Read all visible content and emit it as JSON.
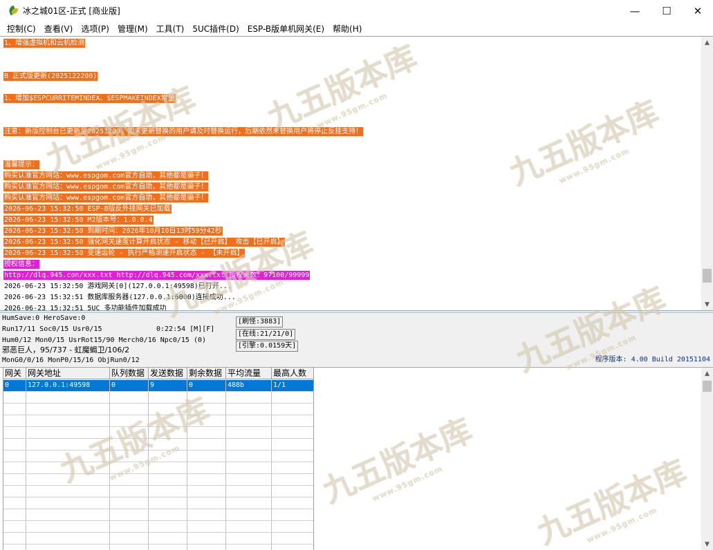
{
  "window": {
    "title": "冰之城01区-正式 [商业版]",
    "minimize": "—",
    "maximize": "☐",
    "close": "✕"
  },
  "menu": [
    {
      "label": "控制(C)"
    },
    {
      "label": "查看(V)"
    },
    {
      "label": "选项(P)"
    },
    {
      "label": "管理(M)"
    },
    {
      "label": "工具(T)"
    },
    {
      "label": "5UC插件(D)"
    },
    {
      "label": "ESP-B版单机网关(E)"
    },
    {
      "label": "帮助(H)"
    }
  ],
  "log": [
    {
      "text": "1、增强虚拟机和云机检测",
      "style": "orange"
    },
    {
      "text": "B 正式版更新(2025122200)",
      "style": "orange"
    },
    {
      "text": "1、增加$ESPCURRITEMINDEX、$ESPMAKEINDEX常量",
      "style": "orange"
    },
    {
      "text": "注意：新版控制台已更新至20251209，如未更新替换的用户请及时替换运行，后期依然未替换用户将停止反挂支持！",
      "style": "orange"
    },
    {
      "text": "温馨提示：",
      "style": "orange"
    },
    {
      "text": "购买认准官方网站：www.espgom.com官方自助，其他都是骗子！",
      "style": "orange"
    },
    {
      "text": "购买认准官方网站：www.espgom.com官方自助，其他都是骗子！",
      "style": "orange"
    },
    {
      "text": "购买认准官方网站：www.espgom.com官方自助，其他都是骗子！",
      "style": "orange"
    },
    {
      "text": "2026-06-23 15:32:50 ESP-B版反外挂网关已加载",
      "style": "orange"
    },
    {
      "text": "2026-06-23 15:32:50 M2版本号：1.0.0.4",
      "style": "orange"
    },
    {
      "text": "2026-06-23 15:32:50 到期时间：2026年10月10日13时59分42秒",
      "style": "orange"
    },
    {
      "text": "2026-06-23 15:32:50 强化网关速度计算开启状态 - 移动【已开启】 攻击【已开启】",
      "style": "orange"
    },
    {
      "text": "2026-06-23 15:32:50 变速齿轮 - 执行严格测速开启状态 - 【未开启】",
      "style": "orange"
    },
    {
      "text": "授权信息：",
      "style": "magenta"
    },
    {
      "text": "http://dlq.945.com/xxx.txt http://dlq.945.com/xxx.txt 授权天数：97100/99999",
      "style": "magenta"
    },
    {
      "text": "2026-06-23 15:32:50 游戏网关[0](127.0.0.1:49598)已打开...",
      "style": "plain"
    },
    {
      "text": "2026-06-23 15:32:51 数据库服务器(127.0.0.1:6000)连接成功...",
      "style": "plain"
    },
    {
      "text": "2026-06-23 15:32:51 5UC 多功能插件加载成功",
      "style": "plain"
    }
  ],
  "status": {
    "line1": "HumSave:0 HeroSave:0",
    "line2": "Run17/11 Soc0/15 Usr0/15",
    "time": "0:22:54 [M][F]",
    "line3": "Hum0/12 Mon0/15 UsrRot15/90 Merch0/16 Npc0/15 (0)",
    "line4": "邪恶巨人，95/737 - 虹魔蝎卫/106/2",
    "line5": "MonG0/0/16 MonP0/15/16 ObjRun0/12",
    "refresh": "[刷怪:3883]",
    "online": "[在线:21/21/0]",
    "engine": "[引擎:0.0159天]",
    "version": "程序版本: 4.00 Build 20151104"
  },
  "gateway_table": {
    "headers": [
      "网关",
      "网关地址",
      "队列数据",
      "发送数据",
      "剩余数据",
      "平均流量",
      "最高人数"
    ],
    "rows": [
      [
        "0",
        "127.0.0.1:49598",
        "0",
        "9",
        "0",
        "488b",
        "1/1"
      ]
    ]
  },
  "watermark": {
    "text": "九五版本库",
    "sub": "www.95gm.com"
  }
}
